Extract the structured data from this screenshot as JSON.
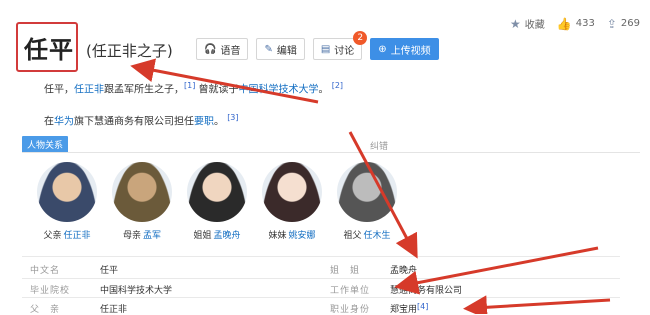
{
  "stats": {
    "favorite_label": "收藏",
    "likes": "433",
    "shares": "269"
  },
  "title": "任平",
  "subtitle": "(任正非之子)",
  "buttons": {
    "voice": "语音",
    "edit": "编辑",
    "discuss": "讨论",
    "discuss_badge": "2",
    "upload": "上传视频"
  },
  "summary": {
    "line1_prefix": "任平，",
    "line1_link1": "任正非",
    "line1_mid": "跟孟军所生之子，",
    "line1_ref1": "[1]",
    "line1_mid2": " 曾就读于",
    "line1_link2": "中国科学技术大学",
    "line1_end": "。",
    "line1_ref2": "[2]",
    "line2_prefix": "在",
    "line2_link1": "华为",
    "line2_mid": "旗下慧通商务有限公司担任",
    "line2_link2": "要职",
    "line2_end": "。",
    "line2_ref": "[3]"
  },
  "relations": {
    "tag": "人物关系",
    "correct": "纠错",
    "persons": [
      {
        "relation": "父亲",
        "name": "任正非",
        "colors": [
          "#3a4a6a",
          "#e8c8a8"
        ]
      },
      {
        "relation": "母亲",
        "name": "孟军",
        "colors": [
          "#6b5a3a",
          "#c9a57c"
        ]
      },
      {
        "relation": "姐姐",
        "name": "孟晚舟",
        "colors": [
          "#2a2a2a",
          "#f0d6c0"
        ]
      },
      {
        "relation": "妹妹",
        "name": "姚安娜",
        "colors": [
          "#3b2a2a",
          "#f5dfd0"
        ]
      },
      {
        "relation": "祖父",
        "name": "任木生",
        "colors": [
          "#555555",
          "#bcbcbc"
        ]
      }
    ]
  },
  "info": {
    "rows": [
      {
        "l1": "中文名",
        "v1": "任平",
        "l2": "姐　姐",
        "v2": "孟晚舟"
      },
      {
        "l1": "毕业院校",
        "v1": "中国科学技术大学",
        "l2": "工作单位",
        "v2": "慧通商务有限公司"
      },
      {
        "l1": "父　亲",
        "v1": "任正非",
        "l2": "职业身份",
        "v2": "郑宝用",
        "ref": "[4]"
      }
    ]
  }
}
